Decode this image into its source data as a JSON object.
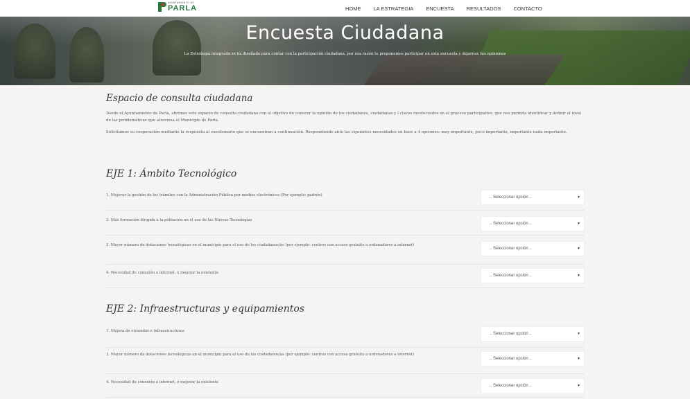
{
  "logo": {
    "small_text": "AYUNTAMIENTO DE",
    "big_text": "PARLA"
  },
  "nav": {
    "items": [
      "HOME",
      "LA ESTRATEGIA",
      "ENCUESTA",
      "RESULTADOS",
      "CONTACTO"
    ]
  },
  "hero": {
    "title": "Encuesta Ciudadana",
    "subtitle": "La Estrategia integrada se ha diseñado para contar con la participación ciudadana, por esa razón te proponemos participar en esta encuesta y dejarnos tus opiniones"
  },
  "intro": {
    "title": "Espacio de consulta ciudadana",
    "paragraphs": [
      "Desde el Ayuntamiento de Parla, abrimos este espacio de consulta ciudadana con el objetivo de conocer la opinión de los ciudadanos, ciudadanas y l claves involucrados en el proceso participativo, que nos permita identificar y definir el nivel de las problemáticas que atraviesa el Municipio de Parla.",
      "Solicitamos su cooperación mediante la respuesta al cuestionario que se encuentran a continuación. Respondiendo ante las siguientes necesidades en base a 4 opciones: muy importante, poco importante, importante nada importante."
    ]
  },
  "select_placeholder": ".. Seleccionar opción ..",
  "axes": [
    {
      "title": "EJE 1: Ámbito Tecnológico",
      "questions": [
        "1. Mejorar la gestión de los trámites con la Administración Pública por medios electrónicos (Por ejemplo: padrón)",
        "2. Más formación dirigida a la población en el uso de las Nuevas Tecnologías",
        "3. Mayor número de dotaciones tecnológicas en el municipio para el uso de los ciudadanos/as (por ejemplo: centros con acceso gratuito a ordenadores a internet)",
        "4. Necesidad de conexión a internet, o mejorar la existente"
      ]
    },
    {
      "title": "EJE 2: Infraestructuras y equipamientos",
      "questions": [
        "1. Mejora de viviendas e infraestructuras",
        "3. Mayor número de dotaciones tecnológicas en el municipio para el uso de los ciudadanos/as (por ejemplo: centros con acceso gratuito a ordenadores a internet)",
        "4. Necesidad de conexión a internet, o mejorar la existente"
      ]
    }
  ]
}
